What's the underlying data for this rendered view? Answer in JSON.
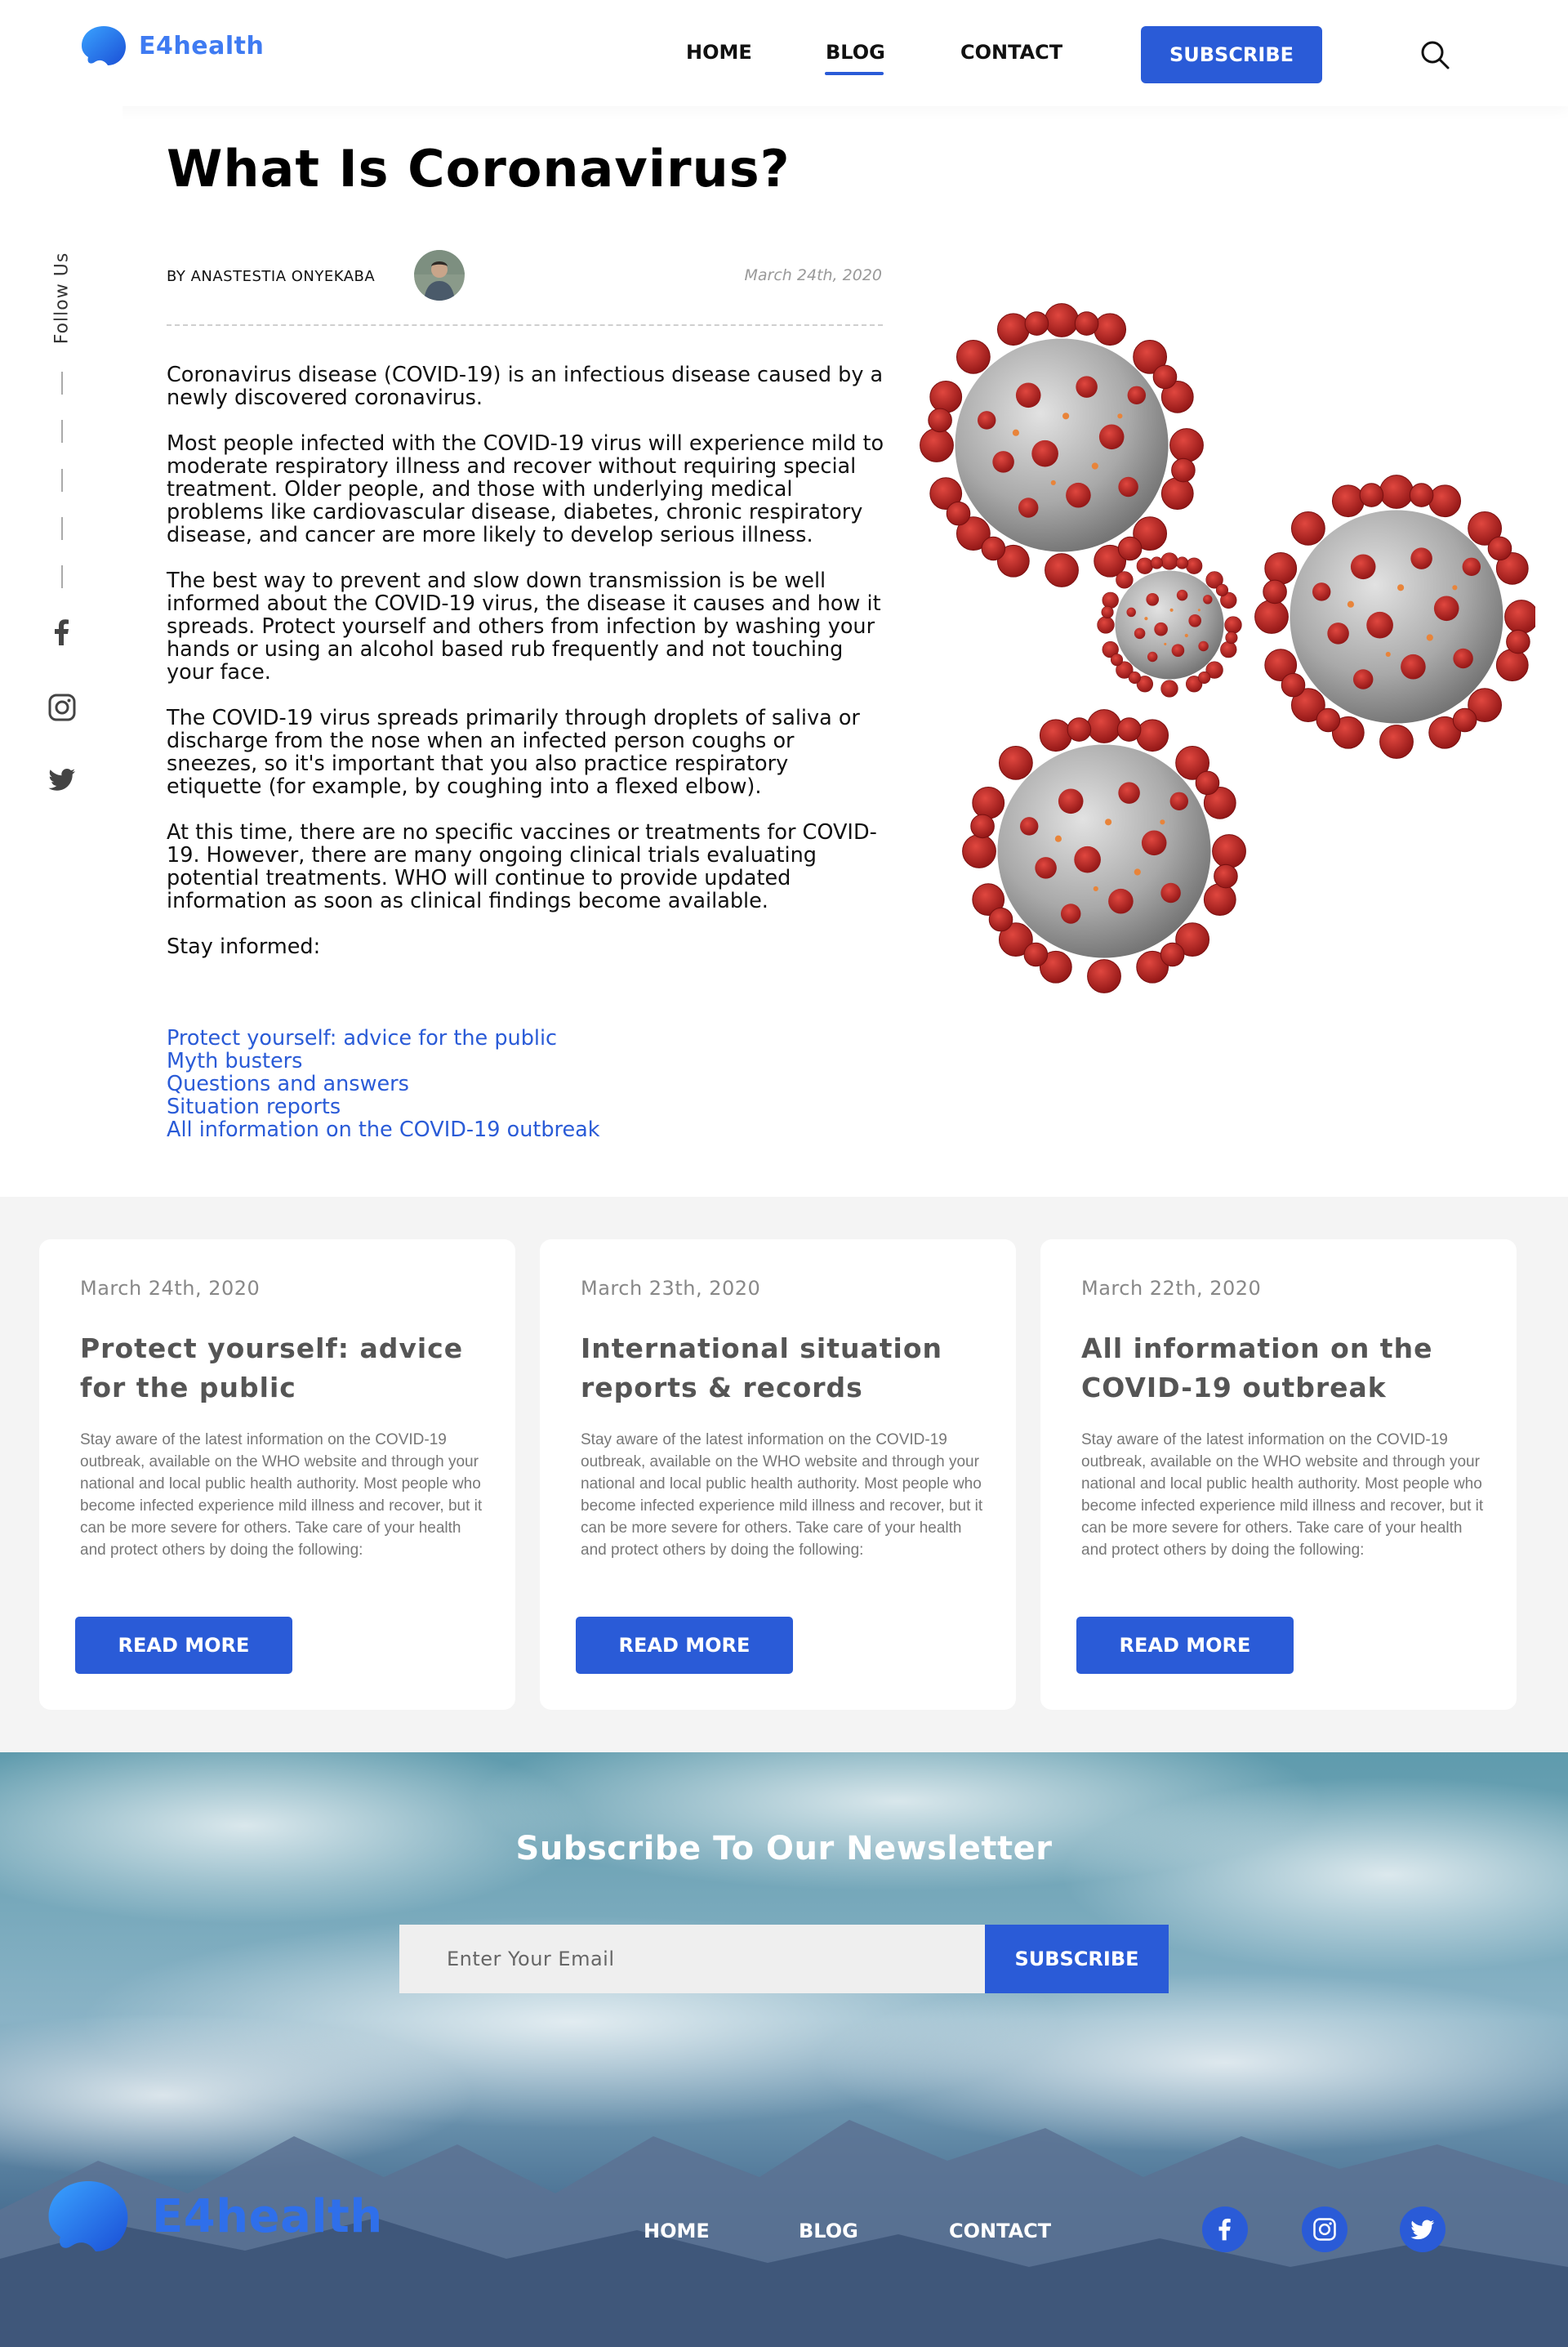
{
  "header": {
    "brand": "E4health",
    "nav": {
      "home": "HOME",
      "blog": "BLOG",
      "contact": "CONTACT"
    },
    "subscribe_label": "SUBSCRIBE",
    "accent_color": "#2a5bd7",
    "brand_color": "#3f7bf2"
  },
  "sidebar": {
    "follow_label": "Follow Us",
    "icons": [
      "facebook-icon",
      "instagram-icon",
      "twitter-icon"
    ]
  },
  "article": {
    "title": "What Is Coronavirus?",
    "byline": "BY ANASTESTIA ONYEKABA",
    "date": "March 24th, 2020",
    "paragraphs": [
      "Coronavirus disease (COVID-19) is an infectious disease caused by a newly discovered coronavirus.",
      "Most people infected with the COVID-19 virus will experience mild to moderate respiratory illness and recover without requiring special treatment.  Older people, and those with underlying medical problems like cardiovascular disease, diabetes, chronic respiratory disease, and cancer are more likely to develop serious illness.",
      "The best way to prevent and slow down transmission is be well informed about the COVID-19 virus, the disease it causes and how it spreads. Protect yourself and others from infection by washing your hands or using an alcohol based rub frequently and not touching your face.",
      "The COVID-19 virus spreads primarily through droplets of saliva or discharge from the nose when an infected person coughs or sneezes, so it's important that you also practice respiratory etiquette (for example, by coughing into a flexed elbow).",
      "At this time, there are no specific vaccines or treatments for COVID-19. However, there are many ongoing clinical trials evaluating potential treatments. WHO will continue to provide updated information as soon as clinical findings become available.",
      "Stay informed:"
    ],
    "links": [
      "Protect yourself: advice for the public",
      "Myth busters",
      "Questions and answers",
      "Situation reports",
      "All information on the COVID-19 outbreak"
    ]
  },
  "cards": [
    {
      "date": "March 24th, 2020",
      "title": "Protect yourself: advice for the public",
      "text": "Stay aware of the latest information on the COVID-19 outbreak, available on the WHO website and through your national and local public health authority. Most people who become infected experience mild illness and recover, but it can be more severe for others. Take care of your health and protect others by doing the following:",
      "button": "READ MORE"
    },
    {
      "date": "March 23th, 2020",
      "title": "International situation reports & records",
      "text": "Stay aware of the latest information on the COVID-19 outbreak, available on the WHO website and through your national and local public health authority. Most people who become infected experience mild illness and recover, but it can be more severe for others. Take care of your health and protect others by doing the following:",
      "button": "READ MORE"
    },
    {
      "date": "March 22th, 2020",
      "title": "All information on the COVID-19 outbreak",
      "text": "Stay aware of the latest information on the COVID-19 outbreak, available on the WHO website and through your national and local public health authority. Most people who become infected experience mild illness and recover, but it can be more severe for others. Take care of your health and protect others by doing the following:",
      "button": "READ MORE"
    }
  ],
  "newsletter": {
    "title": "Subscribe To Our Newsletter",
    "email_placeholder": "Enter Your Email",
    "button": "SUBSCRIBE"
  },
  "footer": {
    "brand": "E4health",
    "nav": {
      "home": "HOME",
      "blog": "BLOG",
      "contact": "CONTACT"
    },
    "social": [
      "facebook-icon",
      "instagram-icon",
      "twitter-icon"
    ]
  }
}
